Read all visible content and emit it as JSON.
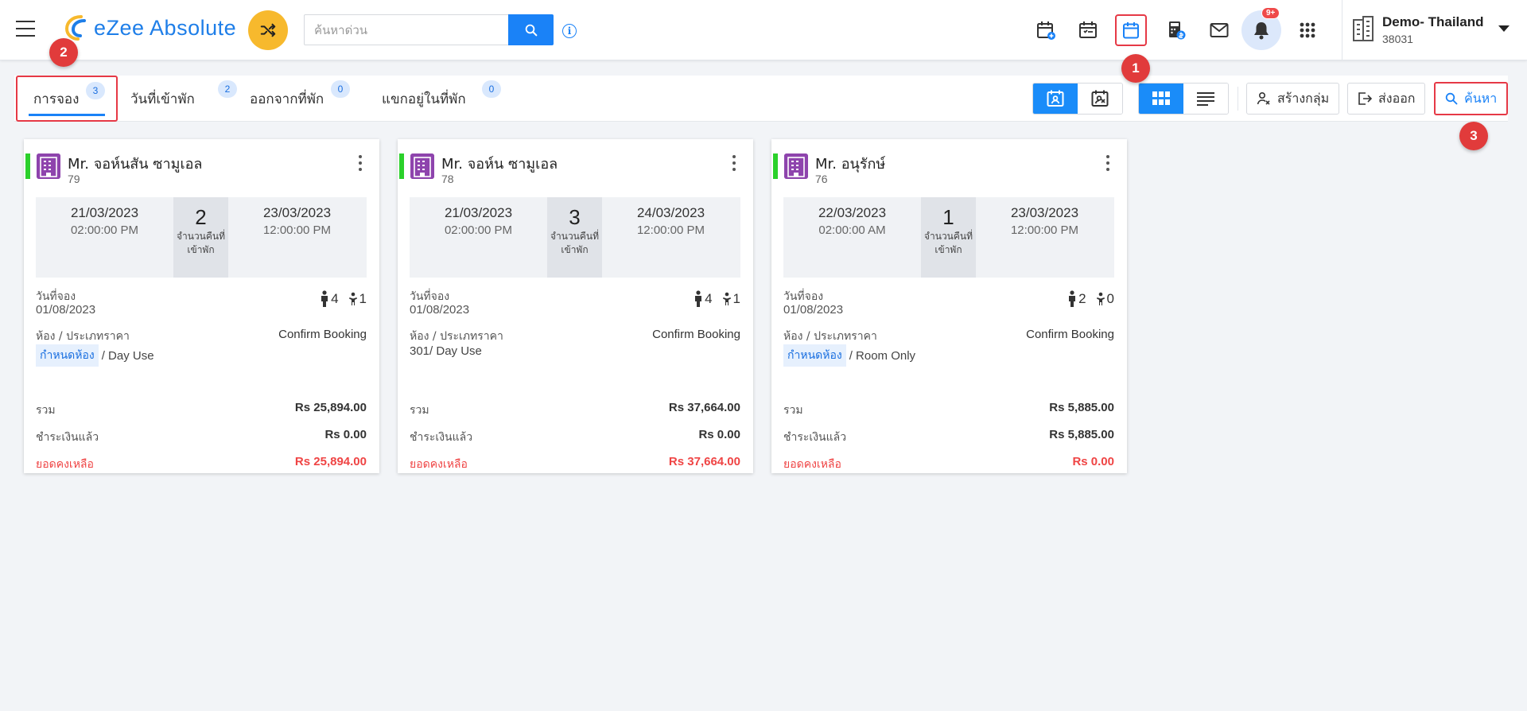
{
  "header": {
    "logo_text": "eZee Absolute",
    "search_placeholder": "ค้นหาด่วน",
    "info_glyph": "i",
    "notification_count": "9+",
    "property_name": "Demo- Thailand",
    "property_id": "38031"
  },
  "markers": [
    "1",
    "2",
    "3"
  ],
  "tabs": [
    {
      "label": "การจอง",
      "count": "3"
    },
    {
      "label": "วันที่เข้าพัก",
      "count": "2"
    },
    {
      "label": "ออกจากที่พัก",
      "count": "0"
    },
    {
      "label": "แขกอยู่ในที่พัก",
      "count": "0"
    }
  ],
  "toolbar": {
    "create_group": "สร้างกลุ่ม",
    "export": "ส่งออก",
    "search": "ค้นหา"
  },
  "labels": {
    "nights": "จำนวนคืนที่เข้าพัก",
    "booking_date": "วันที่จอง",
    "room_rate": "ห้อง / ประเภทราคา",
    "total": "รวม",
    "paid": "ชำระเงินแล้ว",
    "balance": "ยอดคงเหลือ",
    "assign_room": "กำหนดห้อง"
  },
  "bookings": [
    {
      "name": "Mr. จอห์นสัน ซามูเอล",
      "id": "79",
      "arrival_date": "21/03/2023",
      "arrival_time": "02:00:00 PM",
      "nights": "2",
      "departure_date": "23/03/2023",
      "departure_time": "12:00:00 PM",
      "booking_date": "01/08/2023",
      "adults": "4",
      "children": "1",
      "status": "Confirm Booking",
      "room": "",
      "rate_type": "/ Day Use",
      "total": "Rs 25,894.00",
      "paid": "Rs 0.00",
      "balance": "Rs 25,894.00"
    },
    {
      "name": "Mr. จอห์น ซามูเอล",
      "id": "78",
      "arrival_date": "21/03/2023",
      "arrival_time": "02:00:00 PM",
      "nights": "3",
      "departure_date": "24/03/2023",
      "departure_time": "12:00:00 PM",
      "booking_date": "01/08/2023",
      "adults": "4",
      "children": "1",
      "status": "Confirm Booking",
      "room": "301",
      "rate_type": "/ Day Use",
      "total": "Rs 37,664.00",
      "paid": "Rs 0.00",
      "balance": "Rs 37,664.00"
    },
    {
      "name": "Mr. อนุรักษ์",
      "id": "76",
      "arrival_date": "22/03/2023",
      "arrival_time": "02:00:00 AM",
      "nights": "1",
      "departure_date": "23/03/2023",
      "departure_time": "12:00:00 PM",
      "booking_date": "01/08/2023",
      "adults": "2",
      "children": "0",
      "status": "Confirm Booking",
      "room": "",
      "rate_type": "/ Room Only",
      "total": "Rs 5,885.00",
      "paid": "Rs 5,885.00",
      "balance": "Rs 0.00"
    }
  ],
  "colors": {
    "accent": "#1a82f7",
    "highlight": "#e63946",
    "status_stripe": "#2bd12b",
    "balance_red": "#ef4444",
    "shuffle": "#f7b92d"
  }
}
